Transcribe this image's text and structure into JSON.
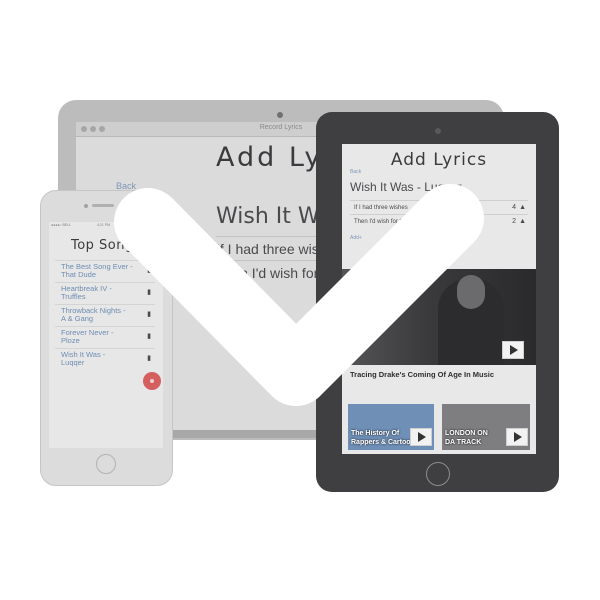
{
  "laptop": {
    "browser_title": "Record Lyrics",
    "heading": "Add Lyrics",
    "back_link": "Back",
    "song_title": "Wish It Was - Luqqer",
    "lyric_lines": [
      "If I had three wishes, it was",
      "Then I'd wish for three again"
    ]
  },
  "tablet": {
    "heading": "Add Lyrics",
    "back_link": "Back",
    "song_title": "Wish It Was - Luqqer",
    "lyric_rows": [
      {
        "text": "If I had three wishes",
        "count": "4"
      },
      {
        "text": "Then I'd wish for three",
        "count": "2"
      }
    ],
    "add_link": "Add+",
    "featured_caption": "Tracing Drake's Coming Of Age In Music",
    "cards": [
      {
        "line1": "The History Of",
        "line2": "Rappers & Cartoons"
      },
      {
        "line1": "LONDON ON",
        "line2": "DA TRACK"
      }
    ]
  },
  "phone": {
    "status_left": "●●●●○ BELL",
    "status_right": "4:21 PM",
    "heading": "Top Songs",
    "songs": [
      {
        "line1": "The Best Song Ever -",
        "line2": "That Dude"
      },
      {
        "line1": "Heartbreak IV -",
        "line2": "Truffles"
      },
      {
        "line1": "Throwback Nights -",
        "line2": "A & Gang"
      },
      {
        "line1": "Forever Never -",
        "line2": "Ploze"
      },
      {
        "line1": "Wish It Was -",
        "line2": "Luqqer"
      }
    ]
  },
  "overlay": {
    "icon": "checkmark-icon",
    "color": "#ffffff"
  }
}
